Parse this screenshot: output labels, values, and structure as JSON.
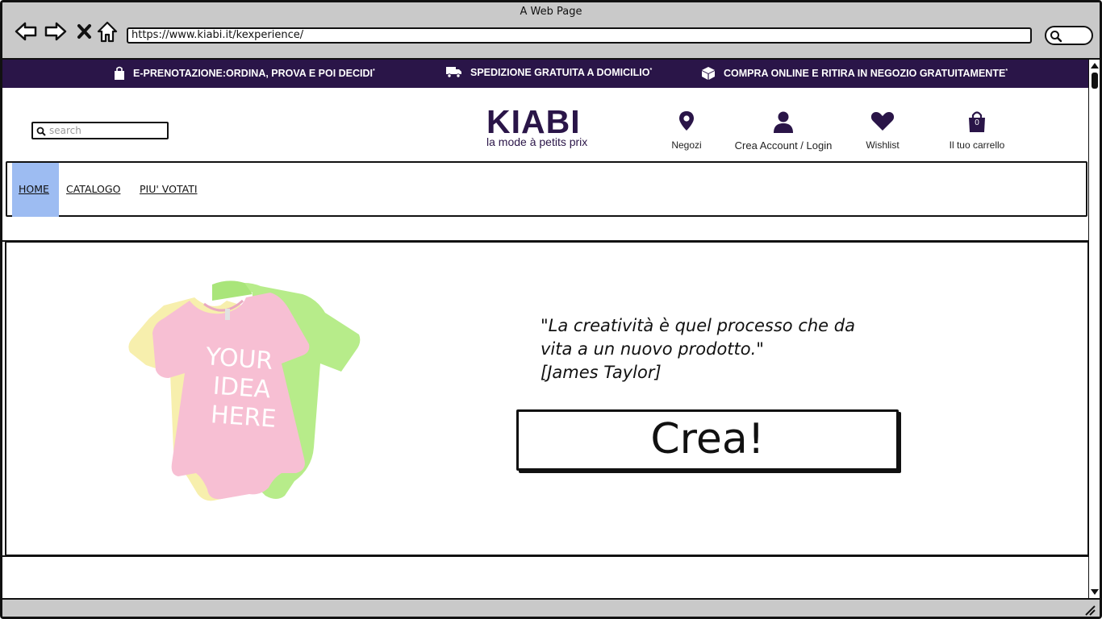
{
  "window": {
    "title": "A Web Page",
    "url": "https://www.kiabi.it/kexperience/"
  },
  "promo": {
    "item1": "E-PRENOTAZIONE:ORDINA, PROVA E POI DECIDI",
    "item2": "SPEDIZIONE GRATUITA A DOMICILIO",
    "item3": "COMPRA ONLINE E RITIRA IN NEGOZIO GRATUITAMENTE",
    "mark": "*",
    "bg_color": "#2a1548"
  },
  "header": {
    "search_placeholder": "search",
    "logo_main": "KIABI",
    "logo_sub": "la mode à petits prix",
    "stores_label": "Negozi",
    "account_label": "Crea Account / Login",
    "wishlist_label": "Wishlist",
    "cart_label": "Il tuo carrello",
    "cart_count": "0"
  },
  "nav": {
    "items": [
      {
        "label": "HOME",
        "active": true
      },
      {
        "label": "CATALOGO",
        "active": false
      },
      {
        "label": "PIU' VOTATI",
        "active": false
      }
    ]
  },
  "hero": {
    "bodysuit_text": [
      "YOUR",
      "IDEA",
      "HERE"
    ],
    "quote_lines": [
      "\"La creatività è quel processo che da",
      "vita a un nuovo prodotto.\"",
      "[James Taylor]"
    ],
    "cta_label": "Crea!"
  }
}
